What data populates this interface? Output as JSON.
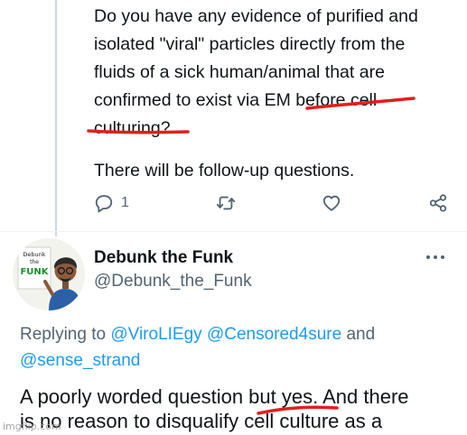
{
  "question_tweet": {
    "lines": [
      "Do you have any evidence of purified and",
      "isolated \"viral\" particles directly from the",
      "fluids of a sick human/animal that are",
      "confirmed to exist via EM before cell",
      "culturing?"
    ],
    "followup": "There will be follow-up questions.",
    "actions": {
      "reply_icon": "reply-icon",
      "reply_count": "1",
      "retweet_icon": "retweet-icon",
      "like_icon": "heart-icon",
      "share_icon": "share-icon"
    }
  },
  "reply_tweet": {
    "avatar_text": [
      "Debunk",
      "the",
      "FUNK"
    ],
    "author_name": "Debunk the Funk",
    "author_handle": "@Debunk_the_Funk",
    "more_icon": "more-options-icon",
    "replying_to_label": "Replying to",
    "mentions": [
      "@ViroLIEgy",
      "@Censored4sure",
      "@sense_strand"
    ],
    "and_word": "and",
    "lines": [
      "A poorly worded question but yes. And there",
      "is no reason to disqualify cell culture as a"
    ]
  },
  "annotations": {
    "underline_color": "#e0201c"
  },
  "watermark": "imgflip.com"
}
